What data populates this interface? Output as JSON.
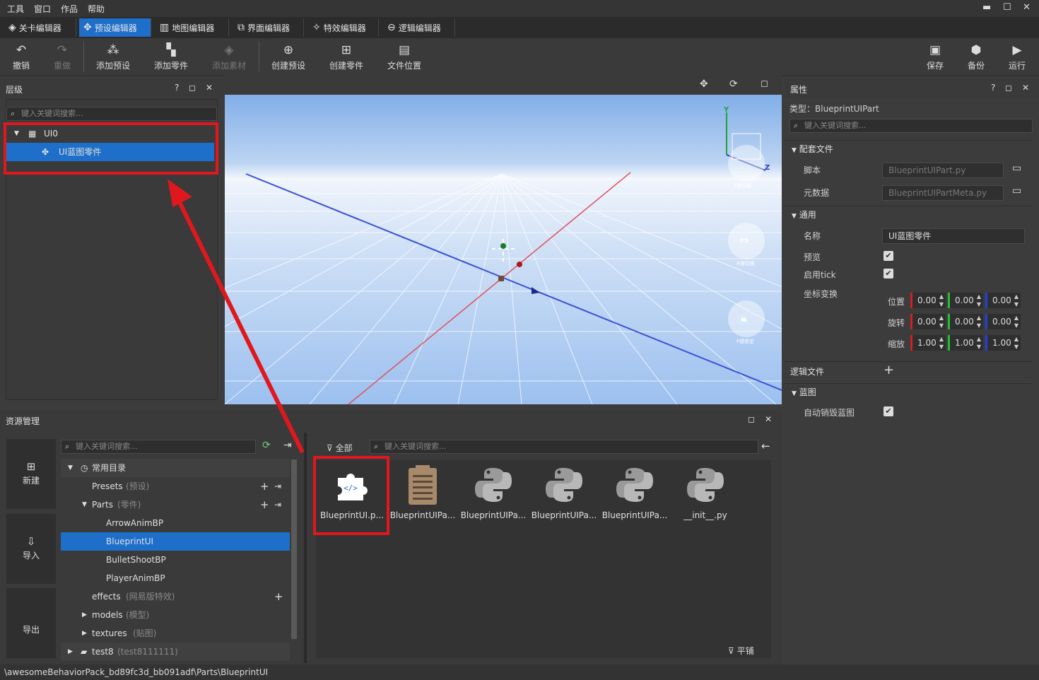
{
  "menu": [
    "工具",
    "窗口",
    "作品",
    "帮助"
  ],
  "tabs": [
    {
      "label": "关卡编辑器",
      "icon": "◈"
    },
    {
      "label": "预设编辑器",
      "icon": "✥"
    },
    {
      "label": "地图编辑器",
      "icon": "▥"
    },
    {
      "label": "界面编辑器",
      "icon": "⧉"
    },
    {
      "label": "特效编辑器",
      "icon": "✧"
    },
    {
      "label": "逻辑编辑器",
      "icon": "⊖"
    }
  ],
  "toolbar": {
    "undo": "撤销",
    "redo": "重做",
    "add_preset": "添加预设",
    "add_part": "添加零件",
    "add_material": "添加素材",
    "create_preset": "创建预设",
    "create_part": "创建零件",
    "file_location": "文件位置",
    "save": "保存",
    "backup": "备份",
    "run": "运行"
  },
  "hierarchy": {
    "title": "层级",
    "search_placeholder": "键入关键词搜索...",
    "root": "UI0",
    "child": "UI蓝图零件"
  },
  "viewport": {
    "axis_y": "Y",
    "axis_z": "Z",
    "gizmo_label_1": "T键切换",
    "gizmo_label_2": "R键切换",
    "gizmo_label_3": "F键锁定"
  },
  "properties": {
    "title": "属性",
    "type_label": "类型：BlueprintUIPart",
    "search_placeholder": "键入关键词搜索...",
    "section_config": "配套文件",
    "script_label": "脚本",
    "script_value": "BlueprintUIPart.py",
    "meta_label": "元数据",
    "meta_value": "BlueprintUIPartMeta.py",
    "section_general": "通用",
    "name_label": "名称",
    "name_value": "UI蓝图零件",
    "preview_label": "预览",
    "tick_label": "启用tick",
    "transform_label": "坐标变换",
    "position_label": "位置",
    "rotation_label": "旋转",
    "scale_label": "缩放",
    "position": [
      "0.00",
      "0.00",
      "0.00"
    ],
    "rotation": [
      "0.00",
      "0.00",
      "0.00"
    ],
    "scale": [
      "1.00",
      "1.00",
      "1.00"
    ],
    "logic_files_label": "逻辑文件",
    "section_blueprint": "蓝图",
    "auto_destroy_label": "自动销毁蓝图"
  },
  "assets": {
    "title": "资源管理",
    "new": "新建",
    "import": "导入",
    "export": "导出",
    "search_placeholder": "键入关键词搜索...",
    "filter_all": "全部",
    "tile_label": "平铺",
    "tree": {
      "common": "常用目录",
      "presets": "Presets",
      "presets_hint": "(预设)",
      "parts": "Parts",
      "parts_hint": "(零件)",
      "arrow": "ArrowAnimBP",
      "blueprint": "BlueprintUI",
      "bullet": "BulletShootBP",
      "player": "PlayerAnimBP",
      "effects": "effects",
      "effects_hint": "(网易版特效)",
      "models": "models",
      "models_hint": "(模型)",
      "textures": "textures",
      "textures_hint": "(贴图)",
      "test8": "test8",
      "test8_hint": "(test8111111)"
    },
    "files": [
      "BlueprintUI.p...",
      "BlueprintUIPa...",
      "BlueprintUIPa...",
      "BlueprintUIPa...",
      "BlueprintUIPa...",
      "__init__.py"
    ]
  },
  "status_path": "\\awesomeBehaviorPack_bd89fc3d_bb091adf\\Parts\\BlueprintUI",
  "colors": {
    "accent": "#1e6fc9",
    "highlight": "#e0181e"
  }
}
